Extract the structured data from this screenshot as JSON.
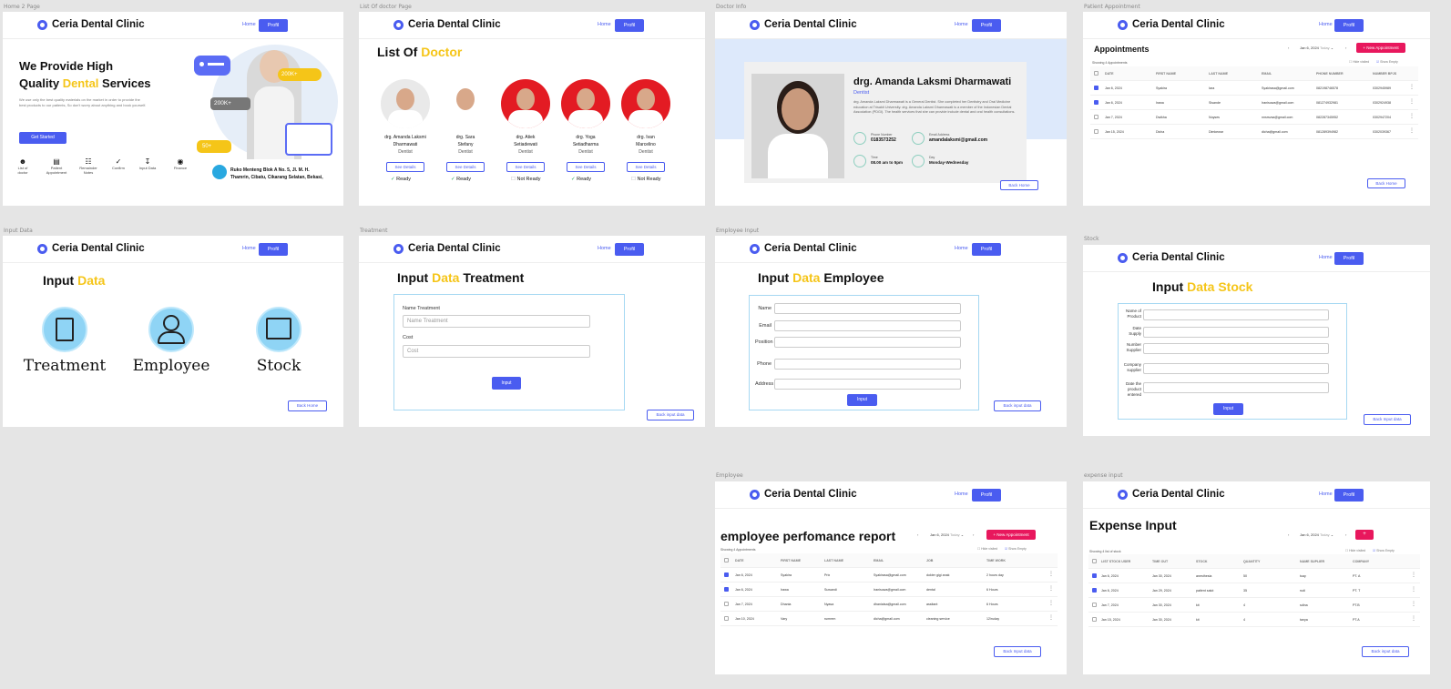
{
  "common": {
    "brand": "Ceria Dental Clinic",
    "home": "Home",
    "profil": "Profil"
  },
  "labels": {
    "home2": "Home 2 Page",
    "list": "List Of doctor Page",
    "info": "Doctor Info",
    "patient": "Patient Appointment",
    "input": "Input Data",
    "treatment": "Treatment",
    "empinput": "Employee Input",
    "stock": "Stock",
    "employee": "Employee",
    "expense": "expense input"
  },
  "home": {
    "title1": "We Provide High",
    "title2a": "Quality ",
    "title2b": "Dental",
    "title2c": " Services",
    "desc": "We use only the best quality materials on the market in order to provide the best products to our patients, So don't worry about anything and book yourself.",
    "cta": "Get Started",
    "badge1": "200K+",
    "badge2": "200K+",
    "badge3": "50+",
    "icons": [
      "List of doctor",
      "Patient Appointment",
      "Remainder Notes",
      "Confirm",
      "Input Data",
      "Finance"
    ],
    "address1": "Ruko Menteng Blok A No. 5, Jl. M. H.",
    "address2": "Thamrin, Cibatu, Cikarang Selatan, Bekasi,"
  },
  "doctors": {
    "title_a": "List Of ",
    "title_b": "Doctor",
    "see": "See Details",
    "items": [
      {
        "name1": "drg. Amanda Laksmi",
        "name2": "Dharmawati",
        "role": "Dentist",
        "status": "Ready",
        "bg": "#e9e9e9"
      },
      {
        "name1": "drg. Sara",
        "name2": "Stefany",
        "role": "Dentist",
        "status": "Ready",
        "bg": "#ffffff"
      },
      {
        "name1": "drg. Atiek",
        "name2": "Setiadewati",
        "role": "Dentist",
        "status": "Not Ready",
        "bg": "#e31b23"
      },
      {
        "name1": "drg. Yoga",
        "name2": "Setiadharma",
        "role": "Dentist",
        "status": "Ready",
        "bg": "#e31b23"
      },
      {
        "name1": "drg. Ivan",
        "name2": "Marcelino",
        "role": "Dentist",
        "status": "Not Ready",
        "bg": "#e31b23"
      }
    ]
  },
  "info": {
    "name": "drg. Amanda Laksmi Dharmawati",
    "role": "Dentist",
    "bio": "drg. Amanda Laksmi Dharmawati is a General Dentist. She completed her Dentistry and Oral Medicine education at Trisakti University. drg. Amanda Laksmi Dharmawati is a member of the Indonesian Dental Association (PDGI). The health services that she can provide include dental and oral health consultations.",
    "phone_l": "Phone Number",
    "phone": "0183573252",
    "email_l": "Email Address",
    "email": "amandalaksmi@gmail.com",
    "time_l": "Time",
    "time": "08.00 am to 5pm",
    "day_l": "Day",
    "day": "Monday-Wednesday",
    "back": "Back Home"
  },
  "appt": {
    "title": "Appointments",
    "date": "Jan 6, 2024",
    "today": "Today",
    "new": "+ New Appointment",
    "hide": "Hide visited",
    "show": "Show Empty",
    "showing": "Showing 4 Appointments",
    "cols": [
      "DATE",
      "FIRST NAME",
      "LAST NAME",
      "EMAIL",
      "PHONE NUMBER",
      "NUMBER BPJS"
    ],
    "rows": [
      {
        "on": true,
        "c": [
          "Jan 6, 2024",
          "Syakira",
          "Iara",
          "Syakirasa@gmail.com",
          "082198746578",
          "0302945989"
        ]
      },
      {
        "on": true,
        "c": [
          "Jan 6, 2024",
          "Irawa",
          "Sisande",
          "Iranisuwa@gmail.com",
          "081274932981",
          "0302924938"
        ]
      },
      {
        "on": false,
        "c": [
          "Jan 7, 2024",
          "Dwikha",
          "Nuyses",
          "nnsrsvsa@gmail.com",
          "082287345952",
          "0302947204"
        ]
      },
      {
        "on": false,
        "c": [
          "Jan 15, 2024",
          "Dicha",
          "Dimkewar",
          "dicha@gmail.com",
          "081289394982",
          "0302039367"
        ]
      }
    ],
    "back": "Back Home"
  },
  "input": {
    "title_a": "Input ",
    "title_b": "Data",
    "items": [
      "Treatment",
      "Employee",
      "Stock"
    ],
    "back": "Back Home"
  },
  "treat": {
    "title_a": "Input ",
    "title_b": "Data",
    "title_c": " Treatment",
    "name_l": "Name Treatment",
    "name_p": "Name Treatment",
    "cost_l": "Cost",
    "cost_p": "Cost",
    "btn": "Input",
    "back": "Back input data"
  },
  "emp": {
    "title_a": "Input ",
    "title_b": "Data",
    "title_c": " Employee",
    "fields": [
      "Name",
      "Email",
      "Position",
      "Phone",
      "Address"
    ],
    "btn": "Input",
    "back": "Back input data"
  },
  "stock": {
    "title_a": "Input ",
    "title_b": "Data Stock",
    "fields": [
      "Name of Product",
      "Date Supply",
      "Number Supplier",
      "Company supplier",
      "Date the product entered"
    ],
    "btn": "Input",
    "back": "Back Input data"
  },
  "perf": {
    "title": "employee perfomance report",
    "date": "Jan 6, 2024",
    "today": "Today",
    "new": "+ New Appointment",
    "hide": "Hide visited",
    "show": "Show Empty",
    "showing": "Showing 4 Appointments",
    "cols": [
      "DATE",
      "FIRST NAME",
      "LAST NAME",
      "EMAIL",
      "JOB",
      "TIME WORK"
    ],
    "rows": [
      {
        "on": true,
        "c": [
          "Jan 6, 2024",
          "Syakira",
          "Prix",
          "Syakirasa@gmail.com",
          "dokter gigi anak",
          "2 hours day"
        ]
      },
      {
        "on": true,
        "c": [
          "Jan 6, 2024",
          "Irawa",
          "Suwandi",
          "Iranisuwa@gmail.com",
          "dental",
          "6 Hours"
        ]
      },
      {
        "on": false,
        "c": [
          "Jan 7, 2024",
          "Dhania",
          "Nyasa",
          "dhaniatsa@gmail.com",
          "assitant",
          "6 Hours"
        ]
      },
      {
        "on": false,
        "c": [
          "Jan 10, 2024",
          "Vary",
          "rumrem",
          "dicha@gmail.com",
          "cleaning service",
          "12/ruday"
        ]
      }
    ],
    "back": "Back Input data"
  },
  "exp": {
    "title": "Expense Input",
    "date": "Jan 6, 2024",
    "today": "Today",
    "new": "+",
    "hide": "Hide visited",
    "show": "Show Empty",
    "showing": "Showing 4 list of stock",
    "cols": [
      "LIST STOCK USER",
      "TIME OUT",
      "STOCK",
      "QUANTITY",
      "NAME SUPLIER",
      "COMPANY"
    ],
    "rows": [
      {
        "on": true,
        "c": [
          "Jan 6, 2024",
          "Jan 30, 2024",
          "anesthesia",
          "50",
          "tuay",
          "PT. A"
        ]
      },
      {
        "on": true,
        "c": [
          "Jan 6, 2024",
          "Jan 29, 2024",
          "patient salut",
          "35",
          "rudi",
          "PT. T"
        ]
      },
      {
        "on": false,
        "c": [
          "Jan 7, 2024",
          "Jan 30, 2024",
          "kit",
          "4",
          "sdina",
          "PT.B"
        ]
      },
      {
        "on": false,
        "c": [
          "Jan 15, 2024",
          "Jan 30, 2024",
          "kit",
          "4",
          "tanya",
          "PT.A"
        ]
      }
    ],
    "back": "Back input data"
  }
}
